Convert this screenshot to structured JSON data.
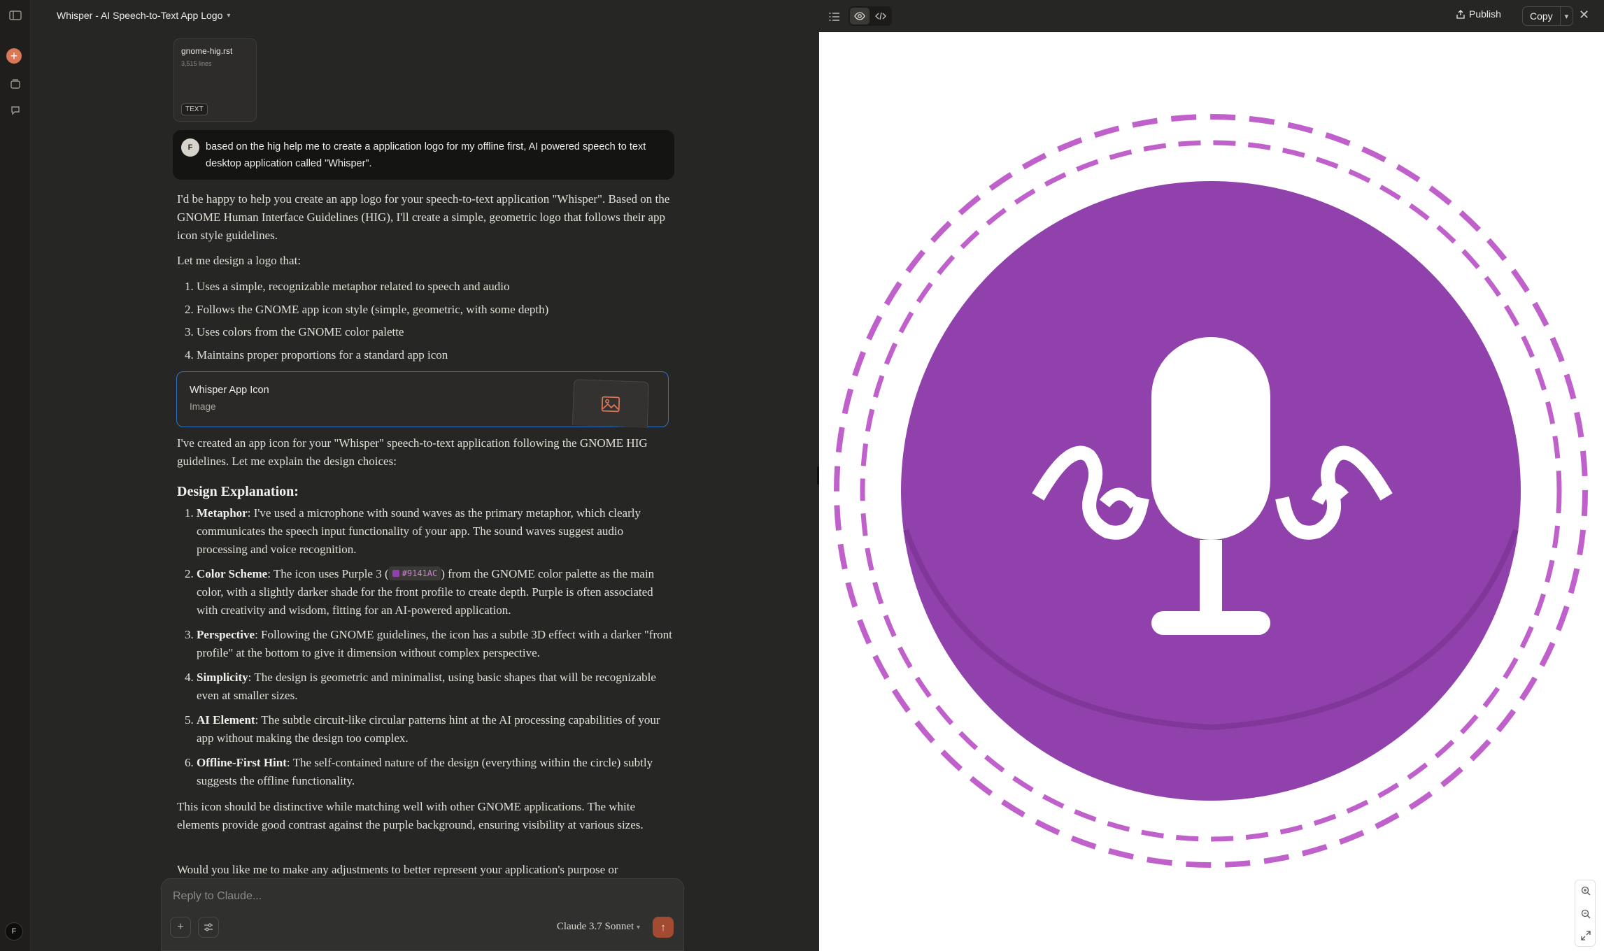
{
  "rail": {
    "new_chat": "+",
    "avatar_initial": "F"
  },
  "chat": {
    "title": "Whisper - AI Speech-to-Text App Logo",
    "attachment": {
      "name": "gnome-hig.rst",
      "lines": "3,515 lines",
      "type": "TEXT"
    },
    "user_initial": "F",
    "user_message": "based on the hig help me to create a application logo for my offline first, AI powered speech to text desktop application called \"Whisper\".",
    "intro": "I'd be happy to help you create an app logo for your speech-to-text application \"Whisper\". Based on the GNOME Human Interface Guidelines (HIG), I'll create a simple, geometric logo that follows their app icon style guidelines.",
    "lead": "Let me design a logo that:",
    "plan": [
      "Uses a simple, recognizable metaphor related to speech and audio",
      "Follows the GNOME app icon style (simple, geometric, with some depth)",
      "Uses colors from the GNOME color palette",
      "Maintains proper proportions for a standard app icon"
    ],
    "artifact": {
      "title": "Whisper App Icon",
      "kind": "Image"
    },
    "after_artifact": "I've created an app icon for your \"Whisper\" speech-to-text application following the GNOME HIG guidelines. Let me explain the design choices:",
    "heading": "Design Explanation:",
    "points": [
      {
        "term": "Metaphor",
        "text": ": I've used a microphone with sound waves as the primary metaphor, which clearly communicates the speech input functionality of your app. The sound waves suggest audio processing and voice recognition."
      },
      {
        "term": "Color Scheme",
        "pre": ": The icon uses Purple 3 (",
        "code": "#9141AC",
        "text": ") from the GNOME color palette as the main color, with a slightly darker shade for the front profile to create depth. Purple is often associated with creativity and wisdom, fitting for an AI-powered application."
      },
      {
        "term": "Perspective",
        "text": ": Following the GNOME guidelines, the icon has a subtle 3D effect with a darker \"front profile\" at the bottom to give it dimension without complex perspective."
      },
      {
        "term": "Simplicity",
        "text": ": The design is geometric and minimalist, using basic shapes that will be recognizable even at smaller sizes."
      },
      {
        "term": "AI Element",
        "text": ": The subtle circuit-like circular patterns hint at the AI processing capabilities of your app without making the design too complex."
      },
      {
        "term": "Offline-First Hint",
        "text": ": The self-contained nature of the design (everything within the circle) subtly suggests the offline functionality."
      }
    ],
    "closing": "This icon should be distinctive while matching well with other GNOME applications. The white elements provide good contrast against the purple background, ensuring visibility at various sizes.",
    "followup": "Would you like me to make any adjustments to better represent your application's purpose or",
    "composer": {
      "placeholder": "Reply to Claude...",
      "model": "Claude 3.7 Sonnet"
    }
  },
  "panel": {
    "publish": "Publish",
    "copy": "Copy",
    "colors": {
      "icon_purple": "#9141AC",
      "ring": "#C061CB",
      "accent": "#D97757"
    }
  }
}
